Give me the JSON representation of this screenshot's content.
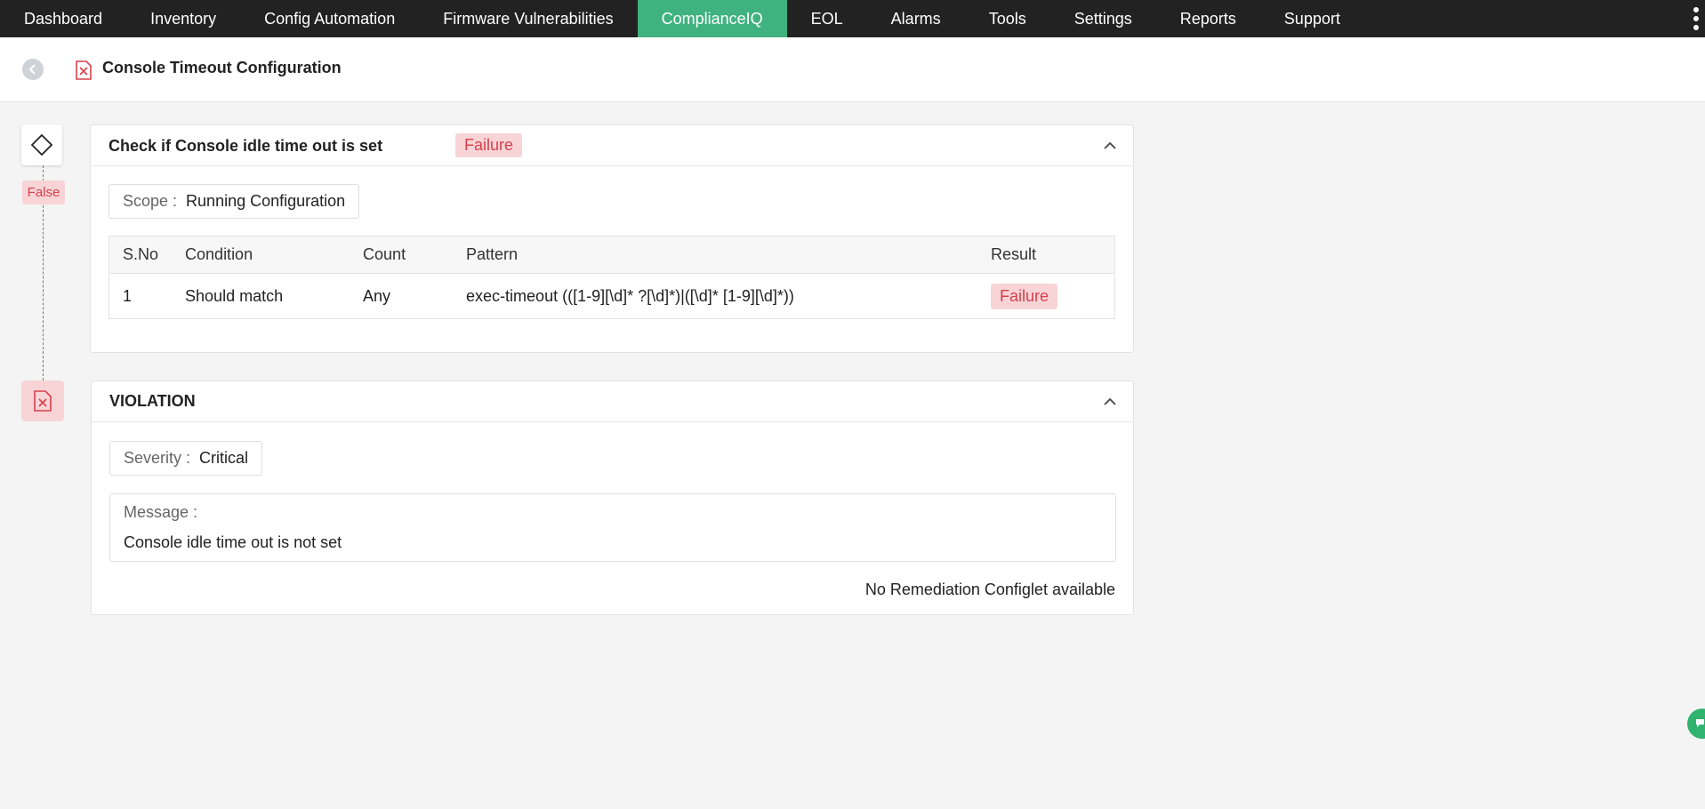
{
  "nav": {
    "items": [
      {
        "label": "Dashboard",
        "active": false
      },
      {
        "label": "Inventory",
        "active": false
      },
      {
        "label": "Config Automation",
        "active": false
      },
      {
        "label": "Firmware Vulnerabilities",
        "active": false
      },
      {
        "label": "ComplianceIQ",
        "active": true
      },
      {
        "label": "EOL",
        "active": false
      },
      {
        "label": "Alarms",
        "active": false
      },
      {
        "label": "Tools",
        "active": false
      },
      {
        "label": "Settings",
        "active": false
      },
      {
        "label": "Reports",
        "active": false
      },
      {
        "label": "Support",
        "active": false
      }
    ],
    "more_icon": "vertical-ellipsis-icon",
    "active_color": "#3fb27f"
  },
  "header": {
    "title": "Console Timeout Configuration",
    "status_icon": "failure-document-icon",
    "back_icon": "chevron-left-icon"
  },
  "timeline": {
    "condition_icon": "diamond-icon",
    "condition_result": "False",
    "violation_icon": "failure-document-icon"
  },
  "check_card": {
    "title": "Check if Console idle time out is set",
    "status": "Failure",
    "scope_label": "Scope :",
    "scope_value": "Running Configuration",
    "table": {
      "headers": [
        "S.No",
        "Condition",
        "Count",
        "Pattern",
        "Result"
      ],
      "rows": [
        {
          "sno": "1",
          "condition": "Should match",
          "count": "Any",
          "pattern": "exec-timeout (([1-9][\\d]* ?[\\d]*)|([\\d]* [1-9][\\d]*))",
          "result": "Failure"
        }
      ]
    }
  },
  "violation_card": {
    "title": "VIOLATION",
    "severity_label": "Severity :",
    "severity_value": "Critical",
    "message_label": "Message :",
    "message_text": "Console idle time out is not set",
    "remediation_text": "No Remediation Configlet available"
  },
  "colors": {
    "failure_bg": "#f8d4d6",
    "failure_text": "#d6414e",
    "chat": "#2fb36f"
  },
  "chat": {
    "icon": "chat-icon"
  }
}
